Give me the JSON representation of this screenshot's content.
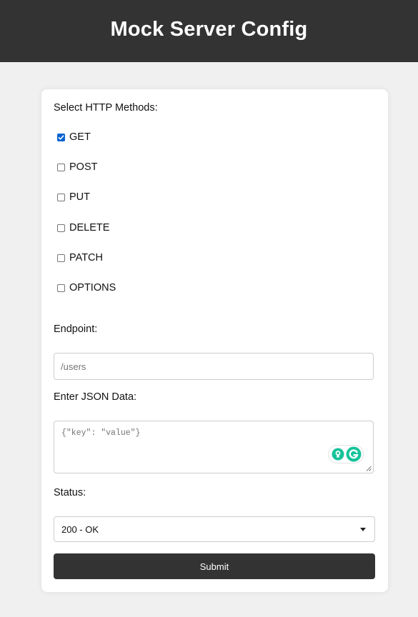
{
  "header": {
    "title": "Mock Server Config"
  },
  "form": {
    "methods_label": "Select HTTP Methods:",
    "methods": [
      {
        "label": "GET",
        "checked": true
      },
      {
        "label": "POST",
        "checked": false
      },
      {
        "label": "PUT",
        "checked": false
      },
      {
        "label": "DELETE",
        "checked": false
      },
      {
        "label": "PATCH",
        "checked": false
      },
      {
        "label": "OPTIONS",
        "checked": false
      }
    ],
    "endpoint_label": "Endpoint:",
    "endpoint_placeholder": "/users",
    "json_label": "Enter JSON Data:",
    "json_placeholder": "{\"key\": \"value\"}",
    "status_label": "Status:",
    "status_selected": "200 - OK",
    "submit_label": "Submit"
  },
  "colors": {
    "header_bg": "#333333",
    "page_bg": "#f0f0f0",
    "checkbox_accent": "#0b63d1",
    "button_bg": "#333333",
    "grammarly_green": "#15c39a"
  },
  "icons": {
    "grammarly": "grammarly-icon",
    "bulb": "lightbulb-icon",
    "dropdown": "caret-down-icon"
  }
}
